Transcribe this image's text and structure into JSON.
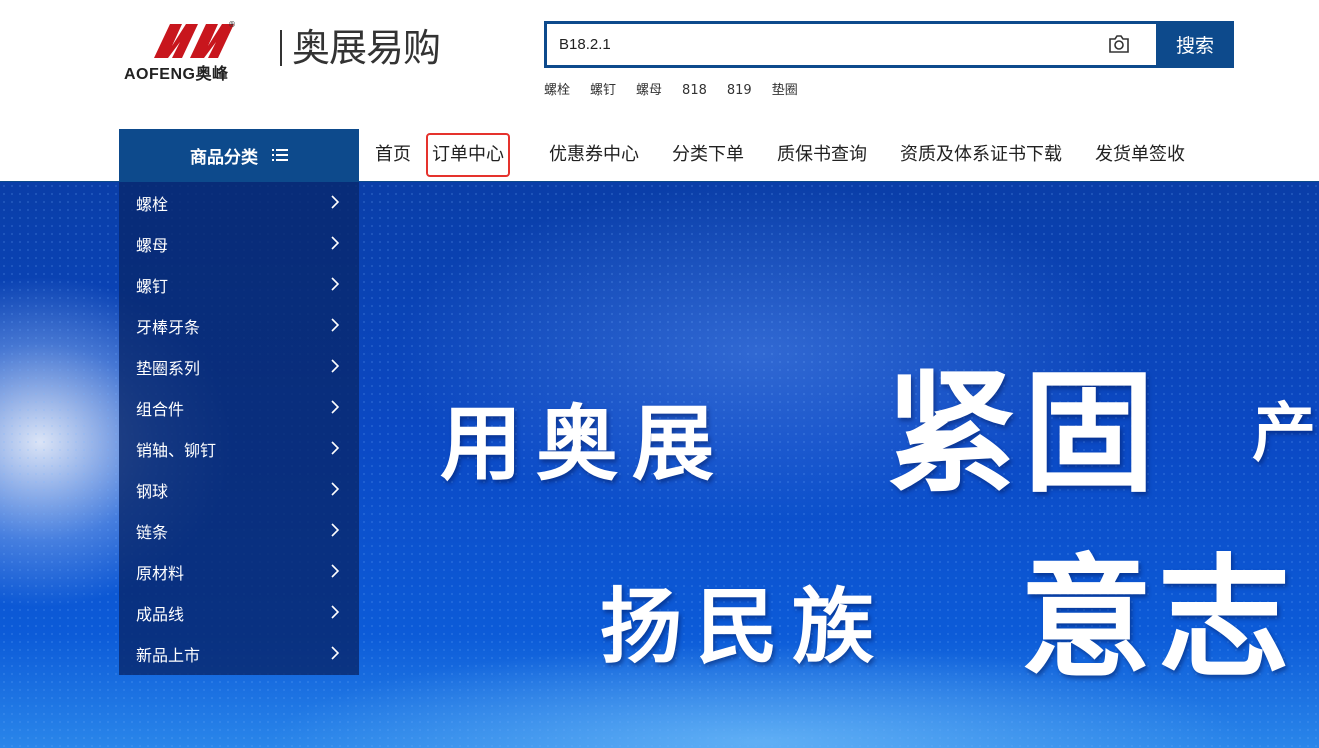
{
  "brand": {
    "logo_text": "AOFENG奥峰",
    "logo_registered": "®",
    "name": "奥展易购",
    "logo_red": "#c8161d"
  },
  "search": {
    "value": "B18.2.1",
    "button_label": "搜索",
    "hot_words": [
      "螺栓",
      "螺钉",
      "螺母",
      "818",
      "819",
      "垫圈"
    ]
  },
  "nav": {
    "category_label": "商品分类",
    "links": [
      "首页",
      "订单中心",
      "优惠券中心",
      "分类下单",
      "质保书查询",
      "资质及体系证书下载",
      "发货单签收"
    ],
    "highlighted_index": 1
  },
  "categories": [
    "螺栓",
    "螺母",
    "螺钉",
    "牙棒牙条",
    "垫圈系列",
    "组合件",
    "销轴、铆钉",
    "钢球",
    "链条",
    "原材料",
    "成品线",
    "新品上市"
  ],
  "banner": {
    "line1_small": "用奥展",
    "line1_big": "紧固",
    "line1_tail": "产",
    "line2_small": "扬民族",
    "line2_big": "意志"
  },
  "colors": {
    "primary": "#0d4a8c",
    "highlight_border": "#e5322d"
  }
}
